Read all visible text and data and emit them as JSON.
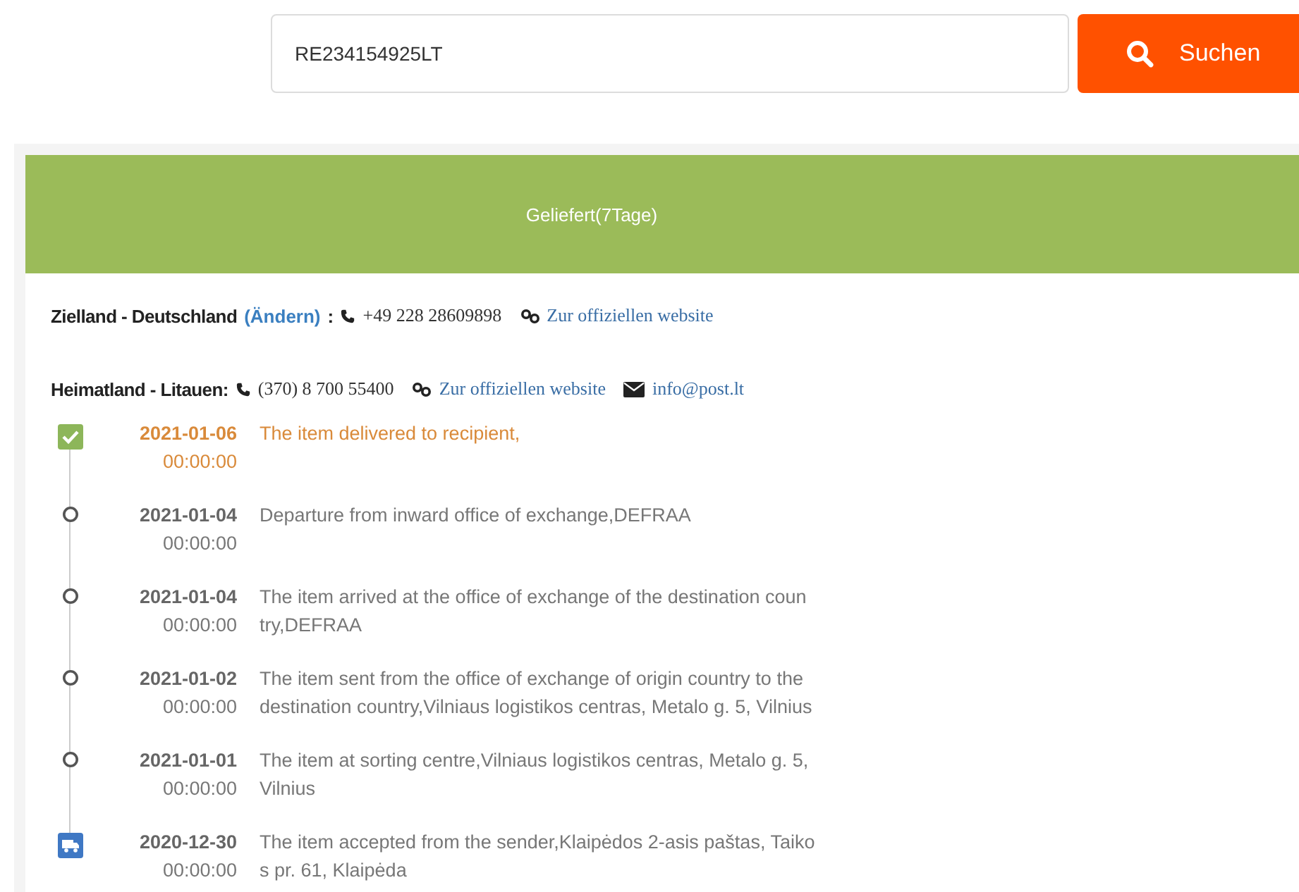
{
  "search": {
    "value": "RE234154925LT",
    "button": "Suchen"
  },
  "status": "Geliefert(7Tage)",
  "destination": {
    "label": "Zielland - Deutschland",
    "change": "(Ändern)",
    "colon": ":",
    "phone": "+49 228 28609898",
    "website": "Zur offiziellen website"
  },
  "origin": {
    "label": "Heimatland - Litauen:",
    "phone": "(370) 8 700 55400",
    "website": "Zur offiziellen website",
    "email": "info@post.lt"
  },
  "events": [
    {
      "kind": "delivered",
      "date": "2021-01-06",
      "time": "00:00:00",
      "lines": [
        "The item delivered to recipient,"
      ]
    },
    {
      "kind": "transit",
      "date": "2021-01-04",
      "time": "00:00:00",
      "lines": [
        "Departure from inward office of exchange,DEFRAA"
      ]
    },
    {
      "kind": "transit",
      "date": "2021-01-04",
      "time": "00:00:00",
      "lines": [
        "The item arrived at the office of exchange of the destination coun",
        "try,DEFRAA"
      ]
    },
    {
      "kind": "transit",
      "date": "2021-01-02",
      "time": "00:00:00",
      "lines": [
        "The item sent from the office of exchange of origin country to the",
        "destination country,Vilniaus logistikos centras, Metalo g. 5, Vilnius"
      ]
    },
    {
      "kind": "transit",
      "date": "2021-01-01",
      "time": "00:00:00",
      "lines": [
        "The item at sorting centre,Vilniaus logistikos centras, Metalo g. 5,",
        "Vilnius"
      ]
    },
    {
      "kind": "accepted",
      "date": "2020-12-30",
      "time": "00:00:00",
      "lines": [
        "The item accepted from the sender,Klaipėdos 2-asis paštas, Taiko",
        "s pr. 61, Klaipėda"
      ]
    }
  ]
}
